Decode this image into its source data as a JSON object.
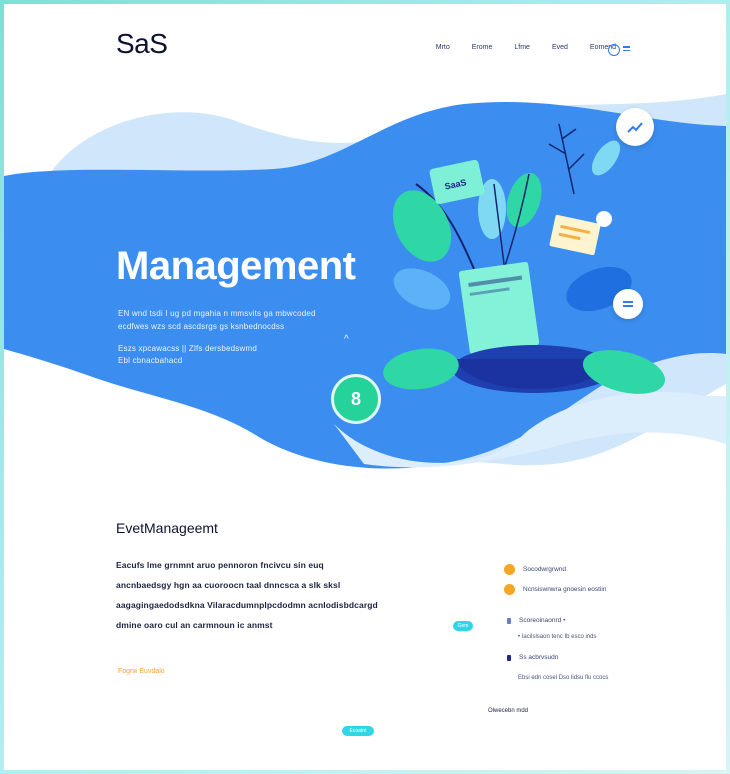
{
  "header": {
    "logo": "SaS",
    "nav": [
      "Mrto",
      "Erome",
      "Lfme",
      "Eved",
      "Eomend"
    ]
  },
  "hero": {
    "title": "Management",
    "lines": [
      "EN wnd tsdi I ug pd mgahia n mmsvits ga mbwcoded",
      "ecdfwes wzs scd ascdsrgs gs ksnbednocdss",
      "Eszs xpcawacss  || Zlfs dersbedswmd",
      "Ebl cbnacbahacd"
    ],
    "fab_glyph": "8",
    "card_text": "SaaS",
    "colors": {
      "primary": "#3b8ef0",
      "accent": "#25d29a",
      "light": "#cfe6fb"
    }
  },
  "content": {
    "title": "EvetManageemt",
    "lines": [
      "Eacufs lme grnmnt aruo pennoron fncivcu sin euq",
      "ancnbaedsgy hgn aa cuoroocn taal dnncsca a slk sksl",
      "aagagingaedodsdkna Vilaracdumnplpcdodmn acnlodisbdcargd",
      "dmine oaro cul an carmnoun ic anmst"
    ],
    "link": "Fogrw Euvdalo",
    "button_small": "Gem",
    "button_bottom": "Ecoatnt",
    "side_items": [
      "Socodwrgrwnd",
      "Ncnsiswnwra gnoesin eostiin",
      "Scoreoinaonrd  •",
      "• Iacilslsaon tenc Ib esco inds",
      "Ss acbrvsudn",
      "Ebsi edn cosel Dso lidsu flu ccocs"
    ],
    "footer_text": "Olwecebn mdd"
  }
}
